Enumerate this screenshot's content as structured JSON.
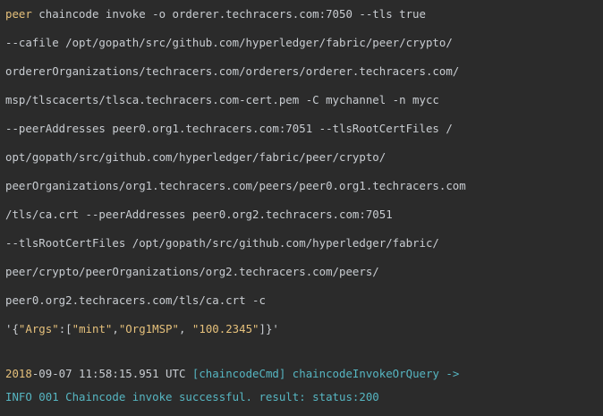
{
  "cmd": {
    "l1_kw": "peer",
    "l1_rest": " chaincode invoke -o orderer.techracers.com:7050 --tls true",
    "l2": "--cafile /opt/gopath/src/github.com/hyperledger/fabric/peer/crypto/",
    "l3": "ordererOrganizations/techracers.com/orderers/orderer.techracers.com/",
    "l4": "msp/tlscacerts/tlsca.techracers.com-cert.pem -C mychannel -n mycc",
    "l5": "--peerAddresses peer0.org1.techracers.com:7051 --tlsRootCertFiles /",
    "l6": "opt/gopath/src/github.com/hyperledger/fabric/peer/crypto/",
    "l7": "peerOrganizations/org1.techracers.com/peers/peer0.org1.techracers.com",
    "l8": "/tls/ca.crt --peerAddresses peer0.org2.techracers.com:7051",
    "l9": "--tlsRootCertFiles /opt/gopath/src/github.com/hyperledger/fabric/",
    "l10": "peer/crypto/peerOrganizations/org2.techracers.com/peers/",
    "l11": "peer0.org2.techracers.com/tls/ca.crt -c"
  },
  "args": {
    "open": "'{",
    "key": "\"Args\"",
    "colon": ":[",
    "v1": "\"mint\"",
    "comma1": ",",
    "v2": "\"Org1MSP\"",
    "comma2": ", ",
    "v3": "\"100.2345\"",
    "close": "]}'"
  },
  "log": {
    "year": "2018",
    "datetime": "-09-07 11:58:15.951 UTC ",
    "tag": "[chaincodeCmd] chaincodeInvokeOrQuery ->",
    "info": "INFO 001 Chaincode invoke successful. result: status:200"
  }
}
